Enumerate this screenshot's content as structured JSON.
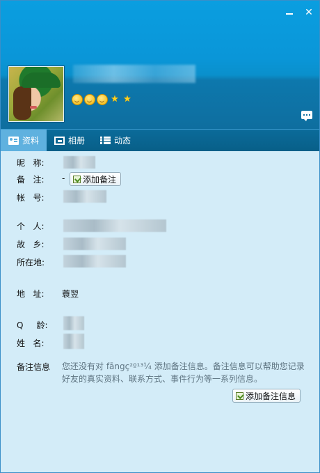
{
  "window": {
    "minimize_label": "–",
    "close_label": "✕"
  },
  "header": {
    "name": "",
    "level_icons": [
      "smile-icon",
      "smile-icon",
      "smile-icon",
      "star-icon",
      "star-icon"
    ]
  },
  "tabs": [
    {
      "label": "资料",
      "icon": "profile-card-icon",
      "active": true
    },
    {
      "label": "相册",
      "icon": "photo-album-icon",
      "active": false
    },
    {
      "label": "动态",
      "icon": "feed-list-icon",
      "active": false
    }
  ],
  "fields": {
    "nickname": {
      "label": "昵   称:"
    },
    "remark": {
      "label": "备   注:",
      "value": "-",
      "button": "添加备注"
    },
    "account": {
      "label": "帐   号:"
    },
    "personal": {
      "label": "个   人:"
    },
    "hometown": {
      "label": "故   乡:"
    },
    "location": {
      "label": "所在地:"
    },
    "address": {
      "label": "地   址:",
      "value": "蓑翌"
    },
    "q_age": {
      "label": "Q     龄:"
    },
    "name": {
      "label": "姓   名:"
    },
    "remark_info": {
      "label": "备注信息",
      "text": "您还没有对 fāngç²º¹³¼ 添加备注信息。备注信息可以帮助您记录好友的真实资料、联系方式、事件行为等一系列信息。",
      "button": "添加备注信息"
    }
  },
  "colors": {
    "header": "#0a9ee0",
    "tab_bar": "#085f88",
    "tab_active": "#5fb1df",
    "panel": "#d3ecf8"
  }
}
